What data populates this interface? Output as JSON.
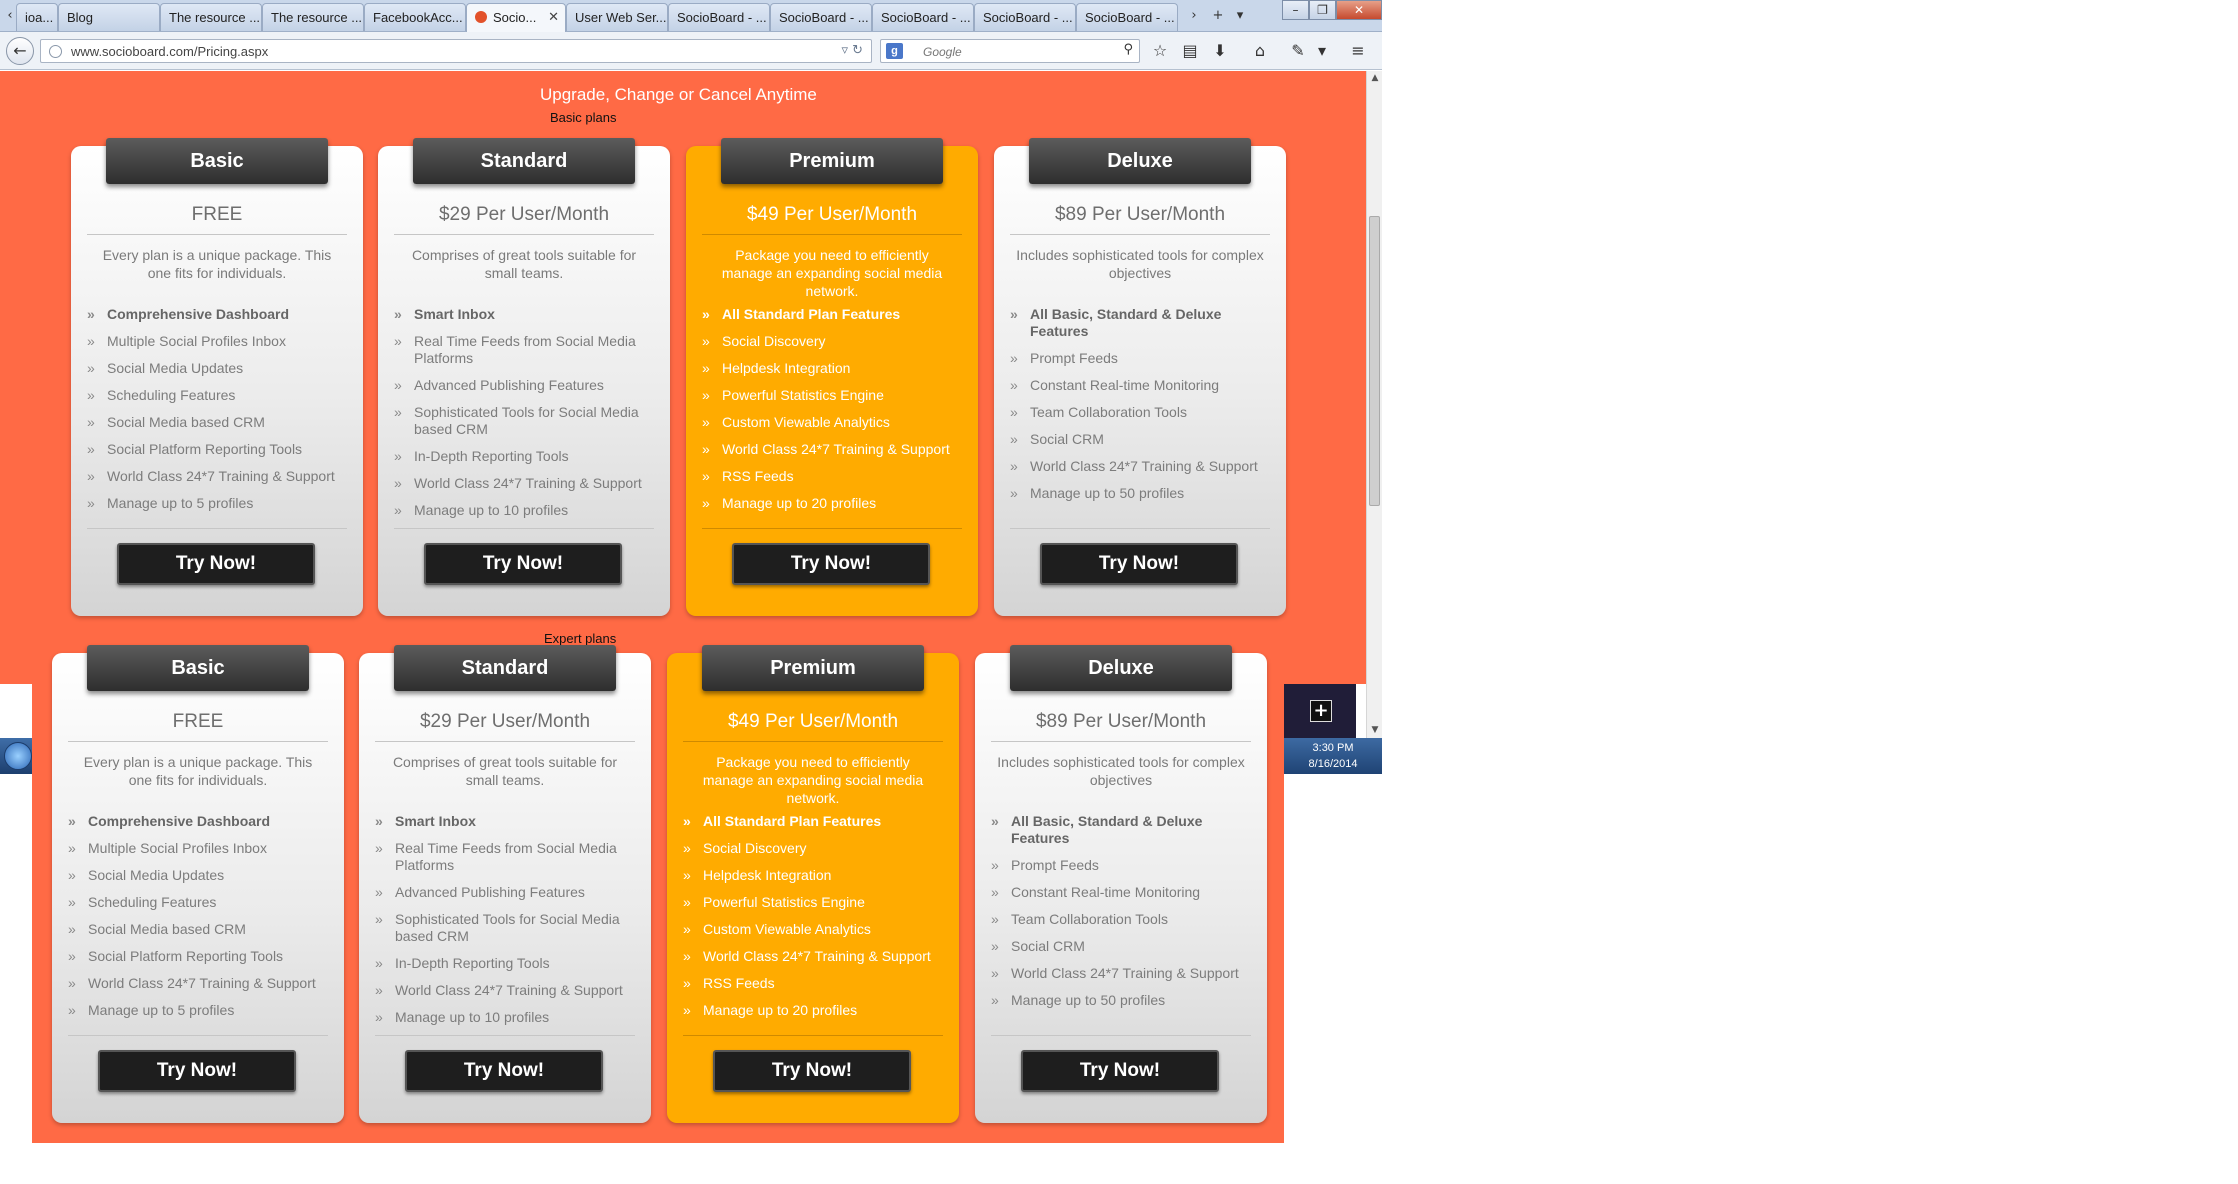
{
  "browser": {
    "tabs": [
      "Blog",
      "The resource ...",
      "The resource ...",
      "FacebookAcc...",
      "Socio...",
      "User Web Ser...",
      "SocioBoard - ...",
      "SocioBoard - ...",
      "SocioBoard - ...",
      "SocioBoard - ...",
      "SocioBoard - ..."
    ],
    "first_tab_fragment": "ioa...",
    "url": "www.socioboard.com/Pricing.aspx",
    "search_placeholder": "Google"
  },
  "page": {
    "headline": "Upgrade, Change or Cancel Anytime",
    "sections": [
      {
        "label": "Basic plans",
        "plans": [
          {
            "name": "Basic",
            "price": "FREE",
            "description": "Every plan is a unique package. This one fits for individuals.",
            "features": [
              "Comprehensive Dashboard",
              "Multiple Social Profiles Inbox",
              "Social Media Updates",
              "Scheduling Features",
              "Social Media based CRM",
              "Social Platform Reporting Tools",
              "World Class 24*7 Training & Support",
              "Manage up to 5 profiles"
            ],
            "button": "Try Now!"
          },
          {
            "name": "Standard",
            "price": "$29 Per User/Month",
            "description": "Comprises of great tools suitable for small teams.",
            "features": [
              "Smart Inbox",
              "Real Time Feeds from Social Media Platforms",
              "Advanced Publishing Features",
              "Sophisticated Tools for Social Media based CRM",
              "In-Depth Reporting Tools",
              "World Class 24*7 Training & Support",
              "Manage up to 10 profiles"
            ],
            "button": "Try Now!"
          },
          {
            "name": "Premium",
            "price": "$49 Per User/Month",
            "description": "Package you need to efficiently manage an expanding social media network.",
            "features": [
              "All Standard Plan Features",
              "Social Discovery",
              "Helpdesk Integration",
              "Powerful Statistics Engine",
              "Custom Viewable Analytics",
              "World Class 24*7 Training & Support",
              "RSS Feeds",
              "Manage up to 20 profiles"
            ],
            "button": "Try Now!"
          },
          {
            "name": "Deluxe",
            "price": "$89 Per User/Month",
            "description": "Includes sophisticated tools for complex objectives",
            "features": [
              "All Basic, Standard & Deluxe Features",
              "Prompt Feeds",
              "Constant Real-time Monitoring",
              "Team Collaboration Tools",
              "Social CRM",
              "World Class 24*7 Training & Support",
              "Manage up to 50 profiles"
            ],
            "button": "Try Now!"
          }
        ]
      },
      {
        "label": "Expert plans",
        "plans": [
          {
            "name": "Basic",
            "price": "FREE",
            "description": "Every plan is a unique package. This one fits for individuals.",
            "features": [
              "Comprehensive Dashboard",
              "Multiple Social Profiles Inbox",
              "Social Media Updates",
              "Scheduling Features",
              "Social Media based CRM",
              "Social Platform Reporting Tools",
              "World Class 24*7 Training & Support",
              "Manage up to 5 profiles"
            ],
            "button": "Try Now!"
          },
          {
            "name": "Standard",
            "price": "$29 Per User/Month",
            "description": "Comprises of great tools suitable for small teams.",
            "features": [
              "Smart Inbox",
              "Real Time Feeds from Social Media Platforms",
              "Advanced Publishing Features",
              "Sophisticated Tools for Social Media based CRM",
              "In-Depth Reporting Tools",
              "World Class 24*7 Training & Support",
              "Manage up to 10 profiles"
            ],
            "button": "Try Now!"
          },
          {
            "name": "Premium",
            "price": "$49 Per User/Month",
            "description": "Package you need to efficiently manage an expanding social media network.",
            "features": [
              "All Standard Plan Features",
              "Social Discovery",
              "Helpdesk Integration",
              "Powerful Statistics Engine",
              "Custom Viewable Analytics",
              "World Class 24*7 Training & Support",
              "RSS Feeds",
              "Manage up to 20 profiles"
            ],
            "button": "Try Now!"
          },
          {
            "name": "Deluxe",
            "price": "$89 Per User/Month",
            "description": "Includes sophisticated tools for complex objectives",
            "features": [
              "All Basic, Standard & Deluxe Features",
              "Prompt Feeds",
              "Constant Real-time Monitoring",
              "Team Collaboration Tools",
              "Social CRM",
              "World Class 24*7 Training & Support",
              "Manage up to 50 profiles"
            ],
            "button": "Try Now!"
          }
        ]
      }
    ]
  },
  "taskbar": {
    "time": "3:30 PM",
    "date": "8/16/2014"
  },
  "colors": {
    "page_bg": "#ff6a45",
    "premium": "#ffab00",
    "ribbon": "#3a3a3a",
    "button": "#1e1e1e"
  },
  "icons": [
    "back-arrow-icon",
    "star-icon",
    "clipboard-icon",
    "download-icon",
    "home-icon",
    "menu-icon",
    "search-icon",
    "refresh-icon",
    "plus-icon",
    "start-orb-icon"
  ]
}
